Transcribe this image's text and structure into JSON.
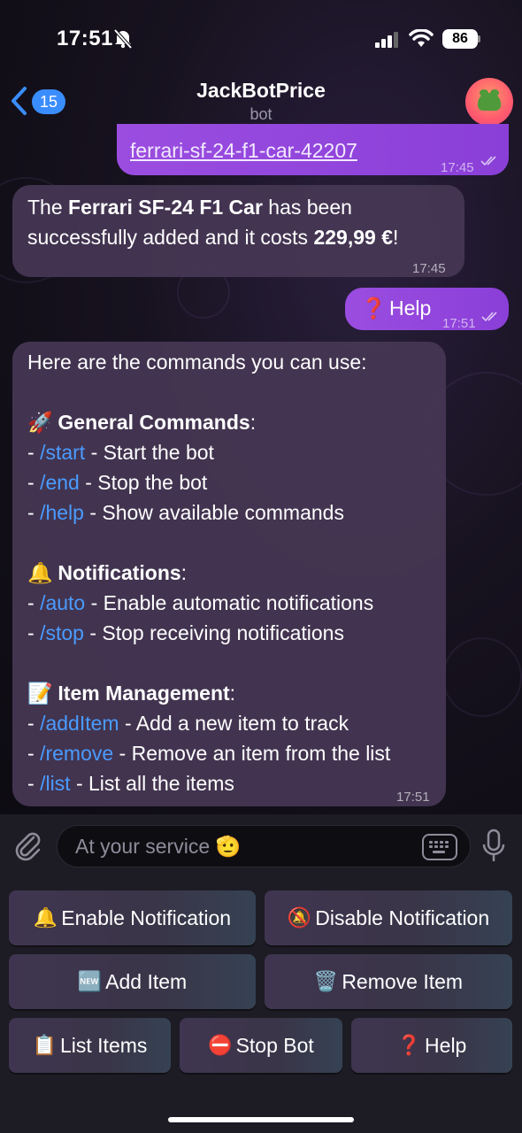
{
  "status": {
    "time": "17:51",
    "battery": "86"
  },
  "header": {
    "back_count": "15",
    "title": "JackBotPrice",
    "subtitle": "bot"
  },
  "messages": {
    "link_msg": {
      "link_text": "ferrari-sf-24-f1-car-42207",
      "time": "17:45"
    },
    "added_msg": {
      "prefix": "The ",
      "item_name": "Ferrari SF-24 F1 Car",
      "middle": " has been successfully added and it costs ",
      "price": "229,99 €",
      "suffix": "!",
      "time": "17:45"
    },
    "help_msg": {
      "icon": "❓",
      "text": "Help",
      "time": "17:51"
    },
    "commands_msg": {
      "intro": "Here are the commands you can use:",
      "sections": [
        {
          "icon": "🚀",
          "title": "General Commands",
          "items": [
            {
              "cmd": "/start",
              "desc": " - Start the bot"
            },
            {
              "cmd": "/end",
              "desc": " - Stop the bot"
            },
            {
              "cmd": "/help",
              "desc": " - Show available commands"
            }
          ]
        },
        {
          "icon": "🔔",
          "title": "Notifications",
          "items": [
            {
              "cmd": "/auto",
              "desc": " - Enable automatic notifications"
            },
            {
              "cmd": "/stop",
              "desc": " - Stop receiving notifications"
            }
          ]
        },
        {
          "icon": "📝",
          "title": "Item Management",
          "items": [
            {
              "cmd": "/addItem",
              "desc": " - Add a new item to track"
            },
            {
              "cmd": "/remove",
              "desc": " - Remove an item from the list"
            },
            {
              "cmd": "/list",
              "desc": " - List all the items"
            }
          ]
        }
      ],
      "time": "17:51"
    }
  },
  "input": {
    "placeholder": "At your service 🫡"
  },
  "keyboard": [
    {
      "icon": "🔔",
      "label": "Enable Notification"
    },
    {
      "icon": "🔕",
      "label": "Disable Notification"
    },
    {
      "icon": "🆕",
      "label": " Add Item"
    },
    {
      "icon": "🗑️",
      "label": "Remove Item"
    },
    {
      "icon": "📋",
      "label": "List Items"
    },
    {
      "icon": "⛔",
      "label": "Stop Bot"
    },
    {
      "icon": "❓",
      "label": " Help"
    }
  ]
}
